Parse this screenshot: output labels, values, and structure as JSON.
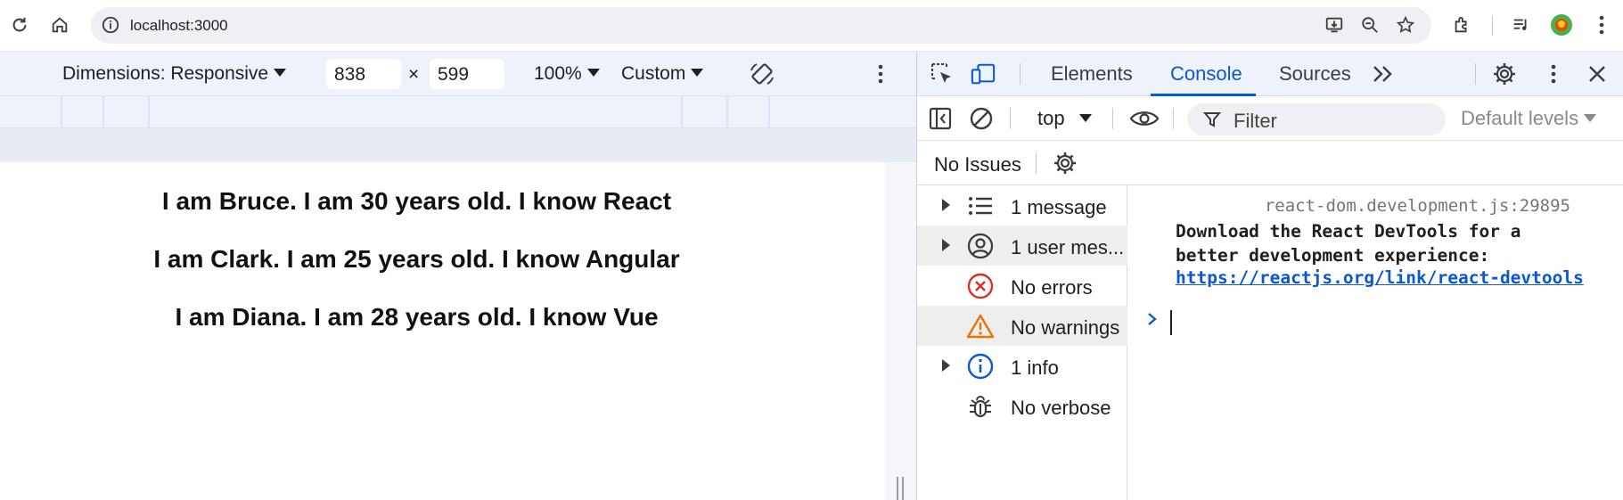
{
  "browser": {
    "url": "localhost:3000"
  },
  "device_toolbar": {
    "dimensions_label": "Dimensions: Responsive",
    "width_value": "838",
    "times": "×",
    "height_value": "599",
    "zoom": "100%",
    "throttle": "Custom"
  },
  "page": {
    "lines": [
      "I am Bruce. I am 30 years old. I know React",
      "I am Clark. I am 25 years old. I know Angular",
      "I am Diana. I am 28 years old. I know Vue"
    ]
  },
  "devtools": {
    "tabs": [
      "Elements",
      "Console",
      "Sources"
    ],
    "active_tab": "Console",
    "context": "top",
    "filter_placeholder": "Filter",
    "levels": "Default levels",
    "issues": "No Issues",
    "sidebar": [
      {
        "label": "1 message",
        "icon": "list-icon"
      },
      {
        "label": "1 user mes...",
        "icon": "user-icon"
      },
      {
        "label": "No errors",
        "icon": "error-icon"
      },
      {
        "label": "No warnings",
        "icon": "warning-icon"
      },
      {
        "label": "1 info",
        "icon": "info-icon"
      },
      {
        "label": "No verbose",
        "icon": "bug-icon"
      }
    ],
    "message": {
      "source": "react-dom.development.js:29895",
      "text": "Download the React DevTools for a better development experience:",
      "link": "https://reactjs.org/link/react-devtools"
    },
    "prompt": ">"
  },
  "colors": {
    "accent": "#0b57d0",
    "error": "#d93025",
    "warning": "#e8710a"
  }
}
